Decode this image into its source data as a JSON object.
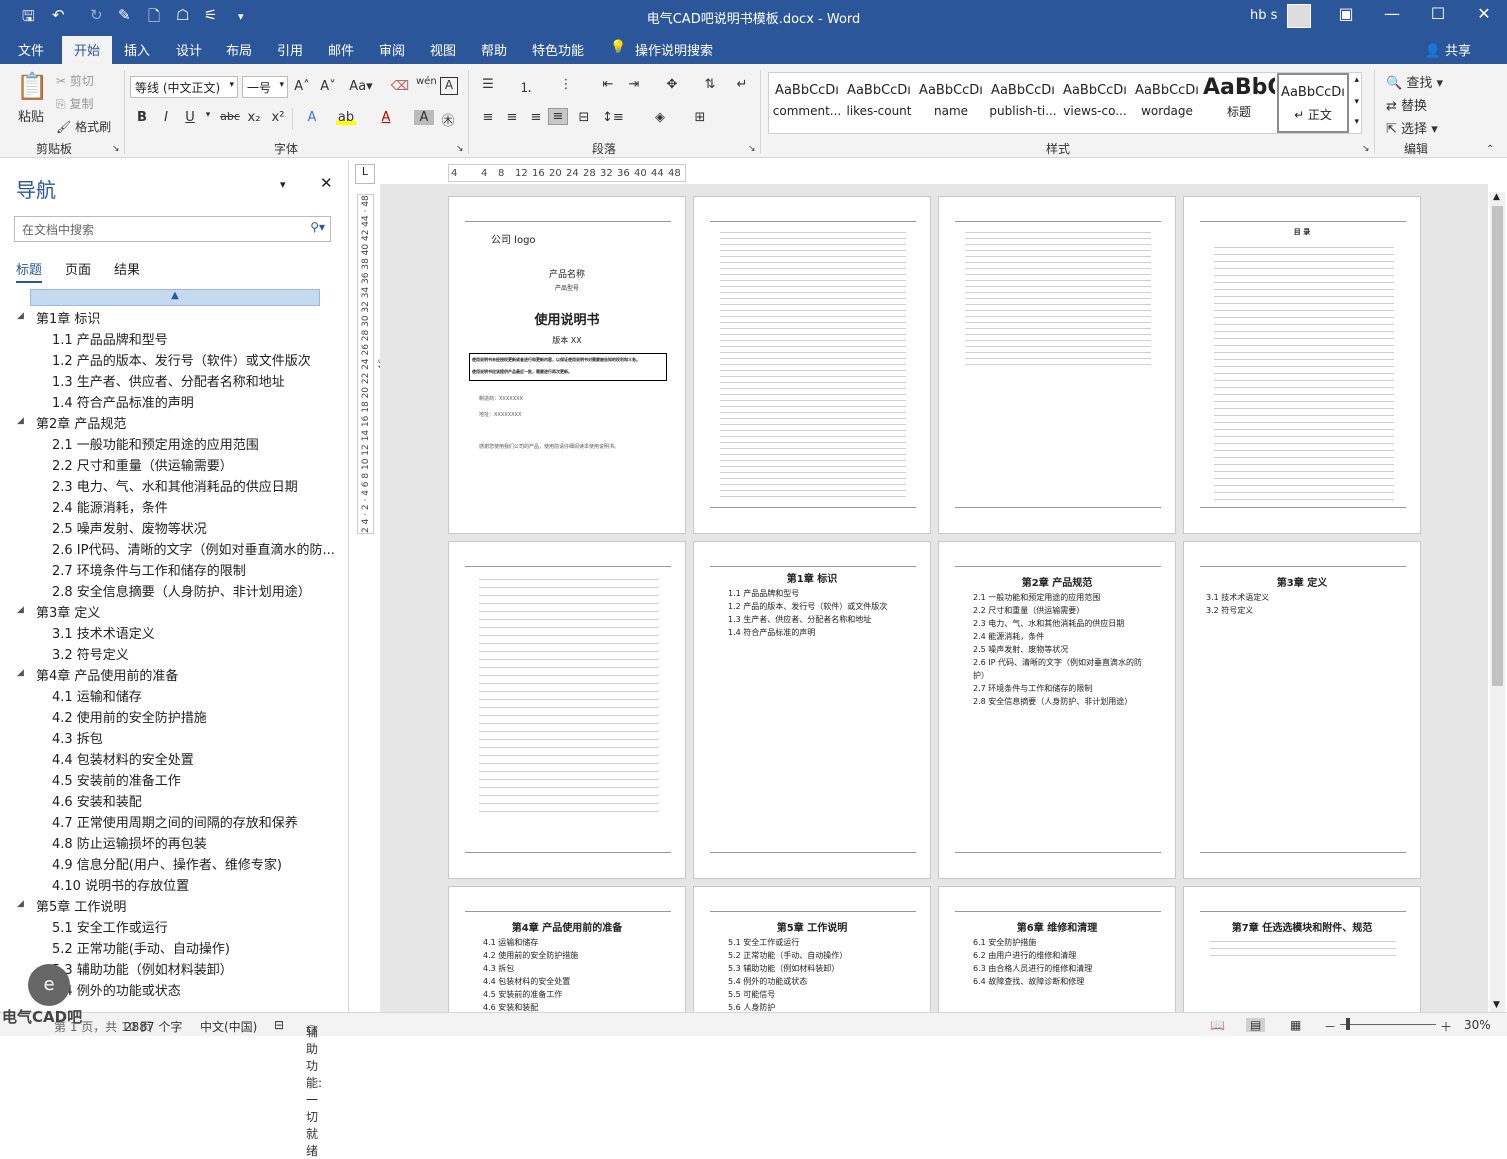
{
  "window": {
    "title": "电气CAD吧说明书模板.docx - Word",
    "user": "hb s"
  },
  "tabs": [
    "文件",
    "开始",
    "插入",
    "设计",
    "布局",
    "引用",
    "邮件",
    "审阅",
    "视图",
    "帮助",
    "特色功能",
    "操作说明搜索"
  ],
  "share": "共享",
  "ribbon": {
    "clipboard": {
      "paste": "粘贴",
      "cut": "剪切",
      "copy": "复制",
      "format_painter": "格式刷",
      "label": "剪贴板"
    },
    "font": {
      "name": "等线 (中文正文)",
      "size": "一号",
      "label": "字体"
    },
    "paragraph": {
      "label": "段落"
    },
    "styles": {
      "label": "样式",
      "items": [
        {
          "sample": "AaBbCcDı",
          "name": "comment..."
        },
        {
          "sample": "AaBbCcDı",
          "name": "likes-count"
        },
        {
          "sample": "AaBbCcDı",
          "name": "name"
        },
        {
          "sample": "AaBbCcDı",
          "name": "publish-ti..."
        },
        {
          "sample": "AaBbCcDı",
          "name": "views-co..."
        },
        {
          "sample": "AaBbCcDı",
          "name": "wordage"
        },
        {
          "sample": "AaBbC",
          "name": "标题"
        },
        {
          "sample": "AaBbCcDı",
          "name": "↵ 正文"
        }
      ]
    },
    "editing": {
      "find": "查找",
      "replace": "替换",
      "select": "选择",
      "label": "编辑"
    }
  },
  "nav": {
    "title": "导航",
    "search_placeholder": "在文档中搜索",
    "tabs": [
      "标题",
      "页面",
      "结果"
    ],
    "items": [
      {
        "level": 1,
        "text": "第1章  标识"
      },
      {
        "level": 2,
        "text": "1.1 产品品牌和型号"
      },
      {
        "level": 2,
        "text": "1.2 产品的版本、发行号（软件）或文件版次"
      },
      {
        "level": 2,
        "text": "1.3 生产者、供应者、分配者名称和地址"
      },
      {
        "level": 2,
        "text": "1.4 符合产品标准的声明"
      },
      {
        "level": 1,
        "text": "第2章  产品规范"
      },
      {
        "level": 2,
        "text": "2.1 一般功能和预定用途的应用范围"
      },
      {
        "level": 2,
        "text": "2.2 尺寸和重量（供运输需要）"
      },
      {
        "level": 2,
        "text": "2.3 电力、气、水和其他消耗品的供应日期"
      },
      {
        "level": 2,
        "text": "2.4 能源消耗，条件"
      },
      {
        "level": 2,
        "text": "2.5 噪声发射、废物等状况"
      },
      {
        "level": 2,
        "text": "2.6 IP代码、清晰的文字（例如对垂直滴水的防..."
      },
      {
        "level": 2,
        "text": "2.7 环境条件与工作和储存的限制"
      },
      {
        "level": 2,
        "text": "2.8 安全信息摘要（人身防护、非计划用途）"
      },
      {
        "level": 1,
        "text": "第3章  定义"
      },
      {
        "level": 2,
        "text": "3.1 技术术语定义"
      },
      {
        "level": 2,
        "text": "3.2 符号定义"
      },
      {
        "level": 1,
        "text": "第4章  产品使用前的准备"
      },
      {
        "level": 2,
        "text": "4.1 运输和储存"
      },
      {
        "level": 2,
        "text": "4.2 使用前的安全防护措施"
      },
      {
        "level": 2,
        "text": "4.3 拆包"
      },
      {
        "level": 2,
        "text": "4.4 包装材料的安全处置"
      },
      {
        "level": 2,
        "text": "4.5 安装前的准备工作"
      },
      {
        "level": 2,
        "text": "4.6 安装和装配"
      },
      {
        "level": 2,
        "text": "4.7 正常使用周期之间的间隔的存放和保养"
      },
      {
        "level": 2,
        "text": "4.8 防止运输损坏的再包装"
      },
      {
        "level": 2,
        "text": "4.9 信息分配(用户、操作者、维修专家)"
      },
      {
        "level": 2,
        "text": "4.10 说明书的存放位置"
      },
      {
        "level": 1,
        "text": "第5章  工作说明"
      },
      {
        "level": 2,
        "text": "5.1 安全工作或运行"
      },
      {
        "level": 2,
        "text": "5.2 正常功能(手动、自动操作)"
      },
      {
        "level": 2,
        "text": "5.3 辅助功能（例如材料装卸）"
      },
      {
        "level": 2,
        "text": "5.4 例外的功能或状态"
      }
    ]
  },
  "ruler": {
    "h_ticks": [
      "4",
      "4",
      "8",
      "12",
      "16",
      "20",
      "24",
      "28",
      "32",
      "36",
      "40",
      "44",
      "48"
    ],
    "v_text": "2 4 · 2 · 4 6 8 10 12 14 16 18 20 22 24 26 28 30 32 34 36 38 40 42 44 · 48 46"
  },
  "pages": {
    "p1": {
      "logo": "公司 logo",
      "product_name": "产品名称",
      "product_model": "产品型号",
      "title": "使用说明书",
      "version": "版本 XX",
      "box1": "使用说明书未经授权更新或者进行和更新内容，以保证使用说明书对需要被告知的权利和义务。",
      "box2": "使用说明书应该提供产品最近一批，需要进行再次更新。",
      "maker": "制造商：XXXXXXX",
      "address": "地址：XXXXXXXX",
      "thanks": "感谢您使用我们公司的产品，使用前请仔细阅读本使用说明书。"
    },
    "p4": {
      "title": "目  录"
    },
    "p6": {
      "title": "第1章  标识",
      "items": [
        "1.1 产品品牌和型号",
        "1.2 产品的版本、发行号（软件）或文件版次",
        "1.3 生产者、供应者、分配者名称和地址",
        "1.4 符合产品标准的声明"
      ]
    },
    "p7": {
      "title": "第2章  产品规范",
      "items": [
        "2.1 一般功能和预定用途的应用范围",
        "2.2 尺寸和重量（供运输需要）",
        "2.3 电力、气、水和其他消耗品的供应日期",
        "2.4 能源消耗，条件",
        "2.5 噪声发射、废物等状况",
        "2.6 IP 代码、清晰的文字（例如对垂直滴水的防",
        "护）",
        "2.7 环境条件与工作和储存的限制",
        "2.8 安全信息摘要（人身防护、非计划用途）"
      ]
    },
    "p8": {
      "title": "第3章  定义",
      "items": [
        "3.1 技术术语定义",
        "3.2 符号定义"
      ]
    },
    "p9": {
      "title": "第4章  产品使用前的准备",
      "items": [
        "4.1 运输和储存",
        "4.2 使用前的安全防护措施",
        "4.3 拆包",
        "4.4 包装材料的安全处置",
        "4.5 安装前的准备工作",
        "4.6 安装和装配"
      ]
    },
    "p10": {
      "title": "第5章  工作说明",
      "items": [
        "5.1 安全工作或运行",
        "5.2 正常功能（手动、自动操作）",
        "5.3 辅助功能（例如材料装卸）",
        "5.4 例外的功能或状态",
        "5.5 可能信号",
        "5.6 人身防护"
      ]
    },
    "p11": {
      "title": "第6章  维修和清理",
      "items": [
        "6.1 安全防护措施",
        "6.2 由用户进行的维修和清理",
        "6.3 由合格人员进行的维修和清理",
        "6.4 故障查找、故障诊断和修理"
      ]
    },
    "p12": {
      "title": "第7章  任选选模块和附件、规范"
    }
  },
  "status": {
    "pages": "第 1 页，共 10 页",
    "words": "2887 个字",
    "lang": "中文(中国)",
    "accessibility": "辅助功能: 一切就绪",
    "zoom": "30%"
  },
  "watermark": "电气CAD吧",
  "watermark_logo": "e"
}
